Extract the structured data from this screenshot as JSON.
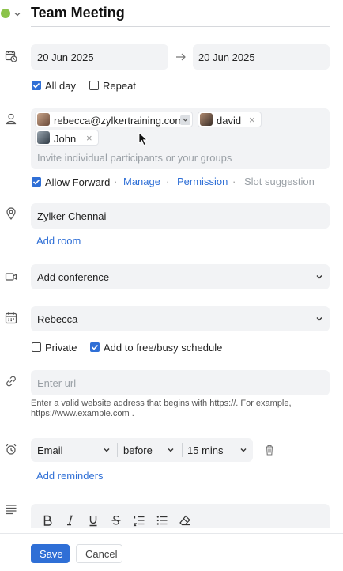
{
  "header": {
    "title": "Team Meeting",
    "status_color": "#8bc34a"
  },
  "dates": {
    "start": "20 Jun 2025",
    "end": "20 Jun 2025"
  },
  "options": {
    "all_day": "All day",
    "all_day_checked": true,
    "repeat": "Repeat",
    "repeat_checked": false
  },
  "participants": {
    "chips": [
      {
        "label": "rebecca@zylkertraining.com"
      },
      {
        "label": "david"
      },
      {
        "label": "John"
      }
    ],
    "placeholder": "Invite individual participants or your groups",
    "allow_forward": "Allow Forward",
    "allow_forward_checked": true,
    "manage": "Manage",
    "permission": "Permission",
    "slot_suggestion": "Slot suggestion"
  },
  "location": {
    "value": "Zylker Chennai",
    "add_room": "Add room"
  },
  "conference": {
    "value": "Add conference"
  },
  "calendar": {
    "value": "Rebecca"
  },
  "visibility": {
    "private": "Private",
    "private_checked": false,
    "free_busy": "Add to free/busy schedule",
    "free_busy_checked": true
  },
  "url": {
    "placeholder": "Enter url",
    "hint_line1": "Enter a valid website address that begins with https://. For example,",
    "hint_line2": "https://www.example.com ."
  },
  "reminder": {
    "type": "Email",
    "relation": "before",
    "time": "15 mins",
    "add_reminders": "Add reminders"
  },
  "footer": {
    "save": "Save",
    "cancel": "Cancel"
  },
  "colors": {
    "accent": "#2f6fd6",
    "field_bg": "#f2f3f5",
    "muted": "#9aa0a6"
  }
}
